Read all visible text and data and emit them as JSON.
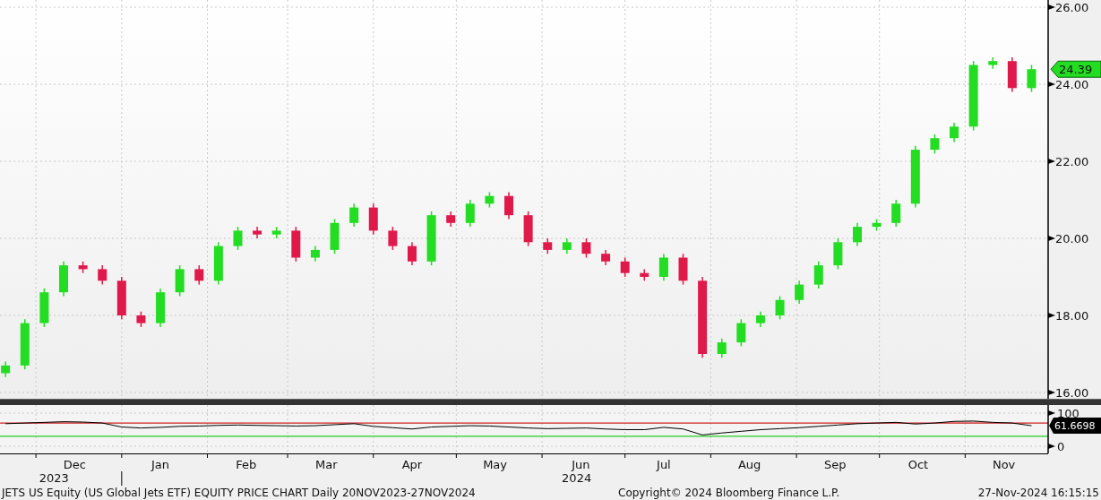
{
  "price_chart": {
    "chart_data": {
      "type": "candlestick",
      "grid": true,
      "x": [
        "2023-11-20",
        "2023-11-27",
        "2023-12-04",
        "2023-12-11",
        "2023-12-18",
        "2023-12-25",
        "2024-01-01",
        "2024-01-08",
        "2024-01-15",
        "2024-01-22",
        "2024-01-29",
        "2024-02-05",
        "2024-02-12",
        "2024-02-19",
        "2024-02-26",
        "2024-03-04",
        "2024-03-11",
        "2024-03-18",
        "2024-03-25",
        "2024-04-01",
        "2024-04-08",
        "2024-04-15",
        "2024-04-22",
        "2024-04-29",
        "2024-05-06",
        "2024-05-13",
        "2024-05-20",
        "2024-05-27",
        "2024-06-03",
        "2024-06-10",
        "2024-06-17",
        "2024-06-24",
        "2024-07-01",
        "2024-07-08",
        "2024-07-15",
        "2024-07-22",
        "2024-07-29",
        "2024-08-05",
        "2024-08-12",
        "2024-08-19",
        "2024-08-26",
        "2024-09-02",
        "2024-09-09",
        "2024-09-16",
        "2024-09-23",
        "2024-09-30",
        "2024-10-07",
        "2024-10-14",
        "2024-10-21",
        "2024-10-28",
        "2024-11-04",
        "2024-11-11",
        "2024-11-18",
        "2024-11-25"
      ],
      "ohlc": [
        [
          16.5,
          16.8,
          16.4,
          16.7
        ],
        [
          16.7,
          17.9,
          16.6,
          17.8
        ],
        [
          17.8,
          18.7,
          17.7,
          18.6
        ],
        [
          18.6,
          19.4,
          18.5,
          19.3
        ],
        [
          19.3,
          19.4,
          19.1,
          19.2
        ],
        [
          19.2,
          19.3,
          18.8,
          18.9
        ],
        [
          18.9,
          19.0,
          17.9,
          18.0
        ],
        [
          18.0,
          18.1,
          17.7,
          17.8
        ],
        [
          17.8,
          18.7,
          17.7,
          18.6
        ],
        [
          18.6,
          19.3,
          18.5,
          19.2
        ],
        [
          19.2,
          19.3,
          18.8,
          18.9
        ],
        [
          18.9,
          19.9,
          18.8,
          19.8
        ],
        [
          19.8,
          20.3,
          19.7,
          20.2
        ],
        [
          20.2,
          20.3,
          20.0,
          20.1
        ],
        [
          20.1,
          20.3,
          20.0,
          20.2
        ],
        [
          20.2,
          20.3,
          19.4,
          19.5
        ],
        [
          19.5,
          19.8,
          19.4,
          19.7
        ],
        [
          19.7,
          20.5,
          19.6,
          20.4
        ],
        [
          20.4,
          20.9,
          20.3,
          20.8
        ],
        [
          20.8,
          20.9,
          20.1,
          20.2
        ],
        [
          20.2,
          20.3,
          19.7,
          19.8
        ],
        [
          19.8,
          19.9,
          19.3,
          19.4
        ],
        [
          19.4,
          20.7,
          19.3,
          20.6
        ],
        [
          20.6,
          20.7,
          20.3,
          20.4
        ],
        [
          20.4,
          21.0,
          20.3,
          20.9
        ],
        [
          20.9,
          21.2,
          20.8,
          21.1
        ],
        [
          21.1,
          21.2,
          20.5,
          20.6
        ],
        [
          20.6,
          20.7,
          19.8,
          19.9
        ],
        [
          19.9,
          20.0,
          19.6,
          19.7
        ],
        [
          19.7,
          20.0,
          19.6,
          19.9
        ],
        [
          19.9,
          20.0,
          19.5,
          19.6
        ],
        [
          19.6,
          19.7,
          19.3,
          19.4
        ],
        [
          19.4,
          19.5,
          19.0,
          19.1
        ],
        [
          19.1,
          19.2,
          18.9,
          19.0
        ],
        [
          19.0,
          19.6,
          18.9,
          19.5
        ],
        [
          19.5,
          19.6,
          18.8,
          18.9
        ],
        [
          18.9,
          19.0,
          16.9,
          17.0
        ],
        [
          17.0,
          17.4,
          16.9,
          17.3
        ],
        [
          17.3,
          17.9,
          17.2,
          17.8
        ],
        [
          17.8,
          18.1,
          17.7,
          18.0
        ],
        [
          18.0,
          18.5,
          17.9,
          18.4
        ],
        [
          18.4,
          18.9,
          18.3,
          18.8
        ],
        [
          18.8,
          19.4,
          18.7,
          19.3
        ],
        [
          19.3,
          20.0,
          19.2,
          19.9
        ],
        [
          19.9,
          20.4,
          19.8,
          20.3
        ],
        [
          20.3,
          20.5,
          20.2,
          20.4
        ],
        [
          20.4,
          21.0,
          20.3,
          20.9
        ],
        [
          20.9,
          22.4,
          20.8,
          22.3
        ],
        [
          22.3,
          22.7,
          22.2,
          22.6
        ],
        [
          22.6,
          23.0,
          22.5,
          22.9
        ],
        [
          22.9,
          24.6,
          22.8,
          24.5
        ],
        [
          24.5,
          24.7,
          24.4,
          24.6
        ],
        [
          24.6,
          24.7,
          23.8,
          23.9
        ],
        [
          23.9,
          24.5,
          23.8,
          24.39
        ]
      ],
      "xlim": [
        "2023-11-18",
        "2024-12-01"
      ],
      "xticks": [
        {
          "value": "2023-12-15",
          "label": "Dec"
        },
        {
          "value": "2024-01-15",
          "label": "Jan"
        },
        {
          "value": "2024-02-15",
          "label": "Feb"
        },
        {
          "value": "2024-03-15",
          "label": "Mar"
        },
        {
          "value": "2024-04-15",
          "label": "Apr"
        },
        {
          "value": "2024-05-15",
          "label": "May"
        },
        {
          "value": "2024-06-15",
          "label": "Jun"
        },
        {
          "value": "2024-07-15",
          "label": "Jul"
        },
        {
          "value": "2024-08-15",
          "label": "Aug"
        },
        {
          "value": "2024-09-15",
          "label": "Sep"
        },
        {
          "value": "2024-10-15",
          "label": "Oct"
        },
        {
          "value": "2024-11-15",
          "label": "Nov"
        }
      ],
      "ylim": [
        16,
        26
      ],
      "yticks": [
        {
          "value": 16,
          "label": "16.00"
        },
        {
          "value": 18,
          "label": "18.00"
        },
        {
          "value": 20,
          "label": "20.00"
        },
        {
          "value": 22,
          "label": "22.00"
        },
        {
          "value": 24,
          "label": "24.00"
        },
        {
          "value": 26,
          "label": "26.00"
        }
      ]
    },
    "last_value": "24.39"
  },
  "rsi_chart": {
    "chart_data": {
      "type": "line",
      "grid": true,
      "series": [
        {
          "color": "#000000",
          "values": [
            68,
            70,
            72,
            74,
            73,
            70,
            58,
            55,
            57,
            60,
            61,
            63,
            64,
            63,
            62,
            61,
            62,
            65,
            68,
            60,
            56,
            52,
            58,
            60,
            62,
            61,
            58,
            55,
            53,
            54,
            55,
            52,
            50,
            50,
            57,
            52,
            34,
            40,
            45,
            50,
            53,
            56,
            60,
            64,
            68,
            70,
            72,
            67,
            70,
            75,
            76,
            72,
            70,
            62
          ]
        }
      ],
      "ylim": [
        0,
        100
      ],
      "yticks": [
        {
          "value": 0,
          "label": "0"
        },
        {
          "value": 100,
          "label": "100"
        }
      ],
      "ref_lines": [
        {
          "axis": "y",
          "value": 70,
          "color": "#cc2222"
        },
        {
          "axis": "y",
          "value": 30,
          "color": "#22cc22"
        }
      ]
    },
    "last_value": "61.6698"
  },
  "time_axis": {
    "years": [
      "2023",
      "2024"
    ]
  },
  "footer": {
    "title": "JETS US Equity (US Global Jets ETF) EQUITY PRICE CHART  Daily 20NOV2023-27NOV2024",
    "copyright": "Copyright© 2024 Bloomberg Finance L.P.",
    "timestamp": "27-Nov-2024 16:15:15"
  }
}
